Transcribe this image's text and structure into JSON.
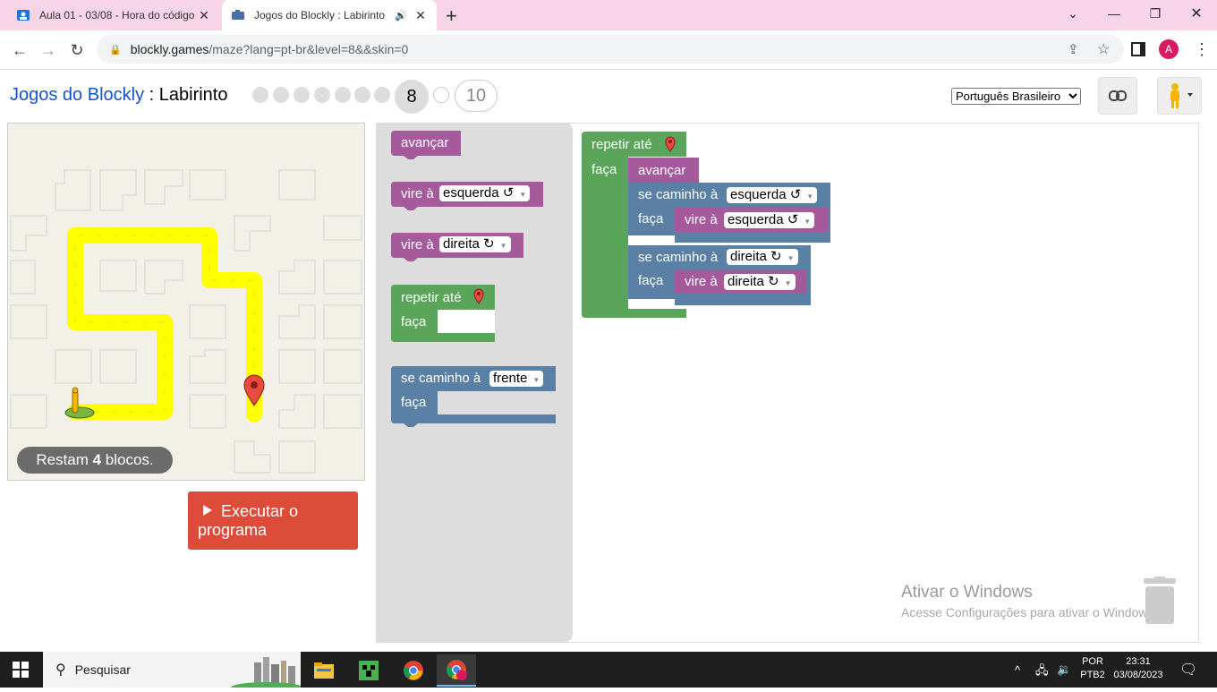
{
  "browser": {
    "tabs": [
      {
        "title": "Aula 01 - 03/08 - Hora do código",
        "icon": "classroom-icon"
      },
      {
        "title": "Jogos do Blockly : Labirinto",
        "icon": "blockly-puzzle-icon",
        "audio": true
      }
    ],
    "url_host": "blockly.games",
    "url_path": "/maze?lang=pt-br&level=8&&skin=0",
    "profile_initial": "A"
  },
  "header": {
    "brand": "Jogos do Blockly",
    "separator": " : ",
    "title": "Labirinto",
    "current_level": "8",
    "last_level": "10",
    "language": "Português Brasileiro",
    "language_options": [
      "Português Brasileiro"
    ]
  },
  "maze": {
    "remaining_prefix": "Restam ",
    "remaining_count": "4",
    "remaining_suffix": " blocos."
  },
  "run_button": "Executar o programa",
  "flyout": {
    "move": "avançar",
    "turn_label": "vire à",
    "left": "esquerda ↺",
    "right": "direita ↻",
    "repeat": "repetir até",
    "do": "faça",
    "if_path": "se caminho à",
    "ahead": "frente"
  },
  "program": {
    "repeat": "repetir até",
    "do": "faça",
    "move": "avançar",
    "if1": "se caminho à",
    "if1_dir": "esquerda ↺",
    "do1": "faça",
    "turn1": "vire à",
    "turn1_dir": "esquerda ↺",
    "if2": "se caminho à",
    "if2_dir": "direita ↻",
    "do2": "faça",
    "turn2": "vire à",
    "turn2_dir": "direita ↻"
  },
  "windows_activation": {
    "title": "Ativar o Windows",
    "subtitle": "Acesse Configurações para ativar o Windows."
  },
  "taskbar": {
    "search_placeholder": "Pesquisar",
    "lang_top": "POR",
    "lang_bottom": "PTB2",
    "time": "23:31",
    "date": "03/08/2023"
  },
  "colors": {
    "move_block": "#a55b9b",
    "turn_block": "#a55b9b",
    "loop_block": "#5ba55b",
    "if_block": "#5b80a5",
    "run_button": "#dd4b39",
    "path": "#ffff00",
    "link": "#1155cc"
  }
}
